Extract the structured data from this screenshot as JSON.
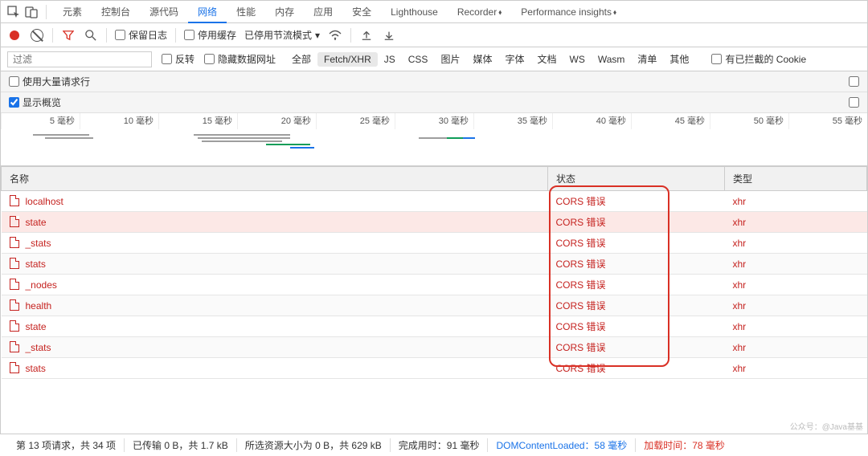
{
  "tabs": {
    "items": [
      "元素",
      "控制台",
      "源代码",
      "网络",
      "性能",
      "内存",
      "应用",
      "安全",
      "Lighthouse",
      "Recorder",
      "Performance insights"
    ],
    "activeIndex": 3,
    "betaIndices": [
      9,
      10
    ]
  },
  "toolbar": {
    "preserve_log": "保留日志",
    "disable_cache": "停用缓存",
    "throttling_label": "已停用节流模式"
  },
  "filter": {
    "placeholder": "过滤",
    "invert": "反转",
    "hide_data_urls": "隐藏数据网址",
    "types": [
      "全部",
      "Fetch/XHR",
      "JS",
      "CSS",
      "图片",
      "媒体",
      "字体",
      "文档",
      "WS",
      "Wasm",
      "清单",
      "其他"
    ],
    "activeTypeIndex": 1,
    "blocked_cookies": "有已拦截的 Cookie"
  },
  "options": {
    "large_rows": "使用大量请求行",
    "show_overview": "显示概览"
  },
  "ruler": {
    "ticks": [
      "5 毫秒",
      "10 毫秒",
      "15 毫秒",
      "20 毫秒",
      "25 毫秒",
      "30 毫秒",
      "35 毫秒",
      "40 毫秒",
      "45 毫秒",
      "50 毫秒",
      "55 毫秒"
    ]
  },
  "table": {
    "headers": {
      "name": "名称",
      "status": "状态",
      "type": "类型"
    },
    "rows": [
      {
        "name": "localhost",
        "status": "CORS 错误",
        "type": "xhr",
        "hl": false
      },
      {
        "name": "state",
        "status": "CORS 错误",
        "type": "xhr",
        "hl": true
      },
      {
        "name": "_stats",
        "status": "CORS 错误",
        "type": "xhr",
        "hl": false
      },
      {
        "name": "stats",
        "status": "CORS 错误",
        "type": "xhr",
        "hl": false
      },
      {
        "name": "_nodes",
        "status": "CORS 错误",
        "type": "xhr",
        "hl": false
      },
      {
        "name": "health",
        "status": "CORS 错误",
        "type": "xhr",
        "hl": false
      },
      {
        "name": "state",
        "status": "CORS 错误",
        "type": "xhr",
        "hl": false
      },
      {
        "name": "_stats",
        "status": "CORS 错误",
        "type": "xhr",
        "hl": false
      },
      {
        "name": "stats",
        "status": "CORS 错误",
        "type": "xhr",
        "hl": false
      }
    ]
  },
  "status": {
    "requests": "第 13 项请求，共 34 项",
    "transferred": "已传输 0 B，共 1.7 kB",
    "resources": "所选资源大小为 0 B，共 629 kB",
    "finish": "完成用时：91 毫秒",
    "dom": "DOMContentLoaded：58 毫秒",
    "load": "加载时间：78 毫秒"
  },
  "watermark": "公众号：@Java基基"
}
